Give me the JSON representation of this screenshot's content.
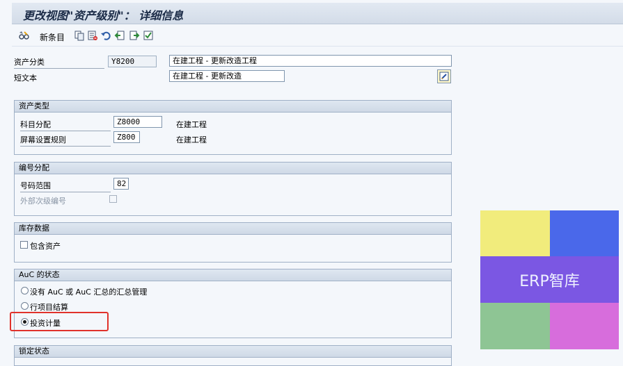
{
  "window": {
    "title": "更改视图\"资产级别\"： 详细信息"
  },
  "toolbar": {
    "new_entries_label": "新条目"
  },
  "header": {
    "asset_class_label": "资产分类",
    "asset_class_value": "Y8200",
    "asset_class_desc": "在建工程 - 更新改造工程",
    "short_text_label": "短文本",
    "short_text_value": "在建工程 - 更新改造"
  },
  "groups": {
    "asset_type": {
      "title": "资产类型",
      "account_determination_label": "科目分配",
      "account_determination_value": "Z8000",
      "account_determination_desc": "在建工程",
      "screen_layout_label": "屏幕设置规则",
      "screen_layout_value": "Z800",
      "screen_layout_desc": "在建工程"
    },
    "number_assignment": {
      "title": "编号分配",
      "number_range_label": "号码范围",
      "number_range_value": "82",
      "ext_subnumber_label": "外部次级编号"
    },
    "inventory_data": {
      "title": "库存数据",
      "include_asset_label": "包含资产"
    },
    "auc_status": {
      "title": "AuC 的状态",
      "options": [
        "没有 AuC 或 AuC 汇总的汇总管理",
        "行项目结算",
        "投资计量"
      ],
      "selected_index": 2
    },
    "lock_status": {
      "title": "锁定状态"
    }
  },
  "watermark": {
    "text": "ERP智库",
    "colors": {
      "top_left": "#f1ec7c",
      "top_right": "#4a68ea",
      "middle": "#7b57e3",
      "bottom_left": "#8ec594",
      "bottom_right": "#d76ddc"
    }
  },
  "icons": {
    "toolbar": [
      "glasses-icon",
      "copy-icon",
      "delete-icon",
      "undo-icon",
      "prev-entry-icon",
      "next-entry-icon",
      "select-icon"
    ],
    "edit": "edit-pencil-icon"
  }
}
